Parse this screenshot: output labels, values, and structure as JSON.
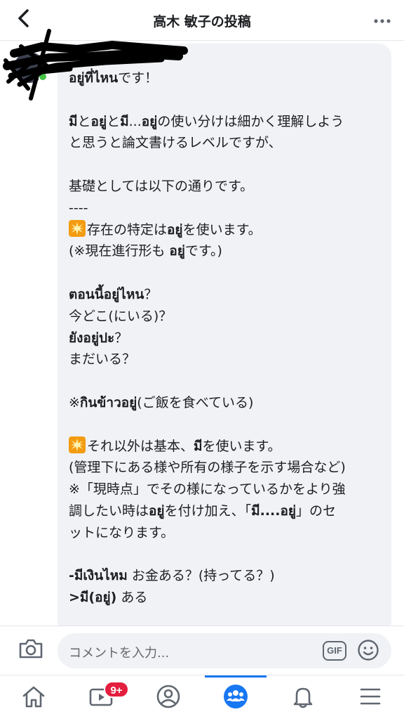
{
  "header": {
    "title": "高木 敏子の投稿",
    "back_icon": "chevron-left-icon",
    "more_icon": "more-horizontal-icon"
  },
  "comment": {
    "lines": [
      [
        {
          "t": "อยู่ที่ไหน",
          "b": true
        },
        {
          "t": "です！"
        }
      ],
      [],
      [
        {
          "t": "มี",
          "b": true
        },
        {
          "t": "と"
        },
        {
          "t": "อยู่",
          "b": true
        },
        {
          "t": "と"
        },
        {
          "t": "มี",
          "b": true
        },
        {
          "t": "..."
        },
        {
          "t": "อยู่",
          "b": true
        },
        {
          "t": "の使い分けは細かく理解しよう"
        }
      ],
      [
        {
          "t": "と思うと論文書けるレベルですが、"
        }
      ],
      [],
      [
        {
          "t": "基礎としては以下の通りです。"
        }
      ],
      [
        {
          "t": "----"
        }
      ],
      [
        {
          "spark": true
        },
        {
          "t": "存在の特定は"
        },
        {
          "t": "อยู่",
          "b": true
        },
        {
          "t": "を使います。"
        }
      ],
      [
        {
          "t": "(※現在進行形も "
        },
        {
          "t": "อยู่",
          "b": true
        },
        {
          "t": "です。)"
        }
      ],
      [],
      [
        {
          "t": "ตอนนี้อยู่ไหน",
          "b": true
        },
        {
          "t": "？"
        }
      ],
      [
        {
          "t": "今どこ(にいる)？"
        }
      ],
      [
        {
          "t": "ยังอยู่ปะ",
          "b": true
        },
        {
          "t": "？"
        }
      ],
      [
        {
          "t": "まだいる？"
        }
      ],
      [],
      [
        {
          "t": "※"
        },
        {
          "t": "กินข้าวอยู่",
          "b": true
        },
        {
          "t": "(ご飯を食べている)"
        }
      ],
      [],
      [
        {
          "spark": true
        },
        {
          "t": "それ以外は基本、"
        },
        {
          "t": "มี",
          "b": true
        },
        {
          "t": "を使います。"
        }
      ],
      [
        {
          "t": "(管理下にある様や所有の様子を示す場合など)"
        }
      ],
      [
        {
          "t": "※「現時点」でその様になっているかをより強"
        }
      ],
      [
        {
          "t": "調したい時は"
        },
        {
          "t": "อยู่",
          "b": true
        },
        {
          "t": "を付け加え、「"
        },
        {
          "t": "มี....อยู่",
          "b": true
        },
        {
          "t": "」のセ"
        }
      ],
      [
        {
          "t": "ットになります。"
        }
      ],
      [],
      [
        {
          "t": "-มีเงินไหม",
          "b": true
        },
        {
          "t": " お金ある？(持ってる？)"
        }
      ],
      [
        {
          "t": ">มี(อยู่)",
          "b": true
        },
        {
          "t": " ある"
        }
      ]
    ]
  },
  "comment_bar": {
    "placeholder": "コメントを入力...",
    "gif_label": "GIF",
    "camera_icon": "camera-icon",
    "emoji_icon": "smiley-icon"
  },
  "bottom_nav": {
    "items": [
      {
        "name": "home",
        "icon": "home-icon"
      },
      {
        "name": "watch",
        "icon": "video-icon",
        "badge": "9+"
      },
      {
        "name": "profile",
        "icon": "profile-icon"
      },
      {
        "name": "groups",
        "icon": "groups-icon",
        "active": true
      },
      {
        "name": "notifications",
        "icon": "bell-icon"
      },
      {
        "name": "menu",
        "icon": "menu-icon"
      }
    ]
  },
  "colors": {
    "accent": "#1877f2",
    "bubble": "#f0f2f5",
    "badge": "#e41e3f",
    "online": "#44c344"
  }
}
